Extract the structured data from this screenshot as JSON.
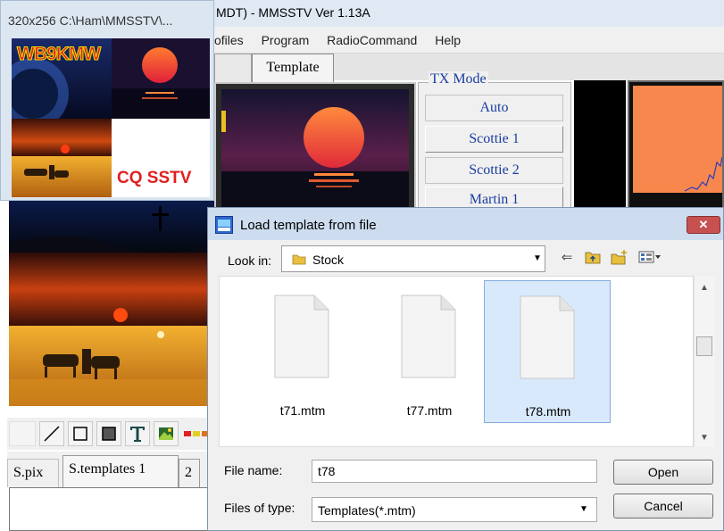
{
  "main_window": {
    "title": "MDT) - MMSSTV Ver 1.13A",
    "menu": [
      "ofiles",
      "Program",
      "RadioCommand",
      "Help"
    ],
    "tab_label": "Template"
  },
  "tx_mode": {
    "label": "TX Mode",
    "buttons": [
      "Auto",
      "Scottie 1",
      "Scottie 2",
      "Martin 1"
    ]
  },
  "left_panel": {
    "tabs": [
      "S.pix",
      "S.templates 1",
      "2"
    ],
    "tool_icons": [
      "line-tool-icon",
      "rectangle-tool-icon",
      "filled-rectangle-tool-icon",
      "text-tool-icon",
      "picture-tool-icon",
      "color-bar-icon"
    ]
  },
  "thumbnail": {
    "title": "320x256 C:\\Ham\\MMSSTV\\...",
    "callsign": "WB9KMW",
    "caption": "CQ SSTV"
  },
  "dialog": {
    "title": "Load template from file",
    "look_in_label": "Look in:",
    "look_in_value": "Stock",
    "files": [
      {
        "name": "t71.mtm",
        "selected": false
      },
      {
        "name": "t77.mtm",
        "selected": false
      },
      {
        "name": "t78.mtm",
        "selected": true
      }
    ],
    "file_name_label": "File name:",
    "file_name_value": "t78",
    "file_type_label": "Files of type:",
    "file_type_value": "Templates(*.mtm)",
    "open_label": "Open",
    "cancel_label": "Cancel"
  },
  "colors": {
    "accent_blue": "#1a3ca0",
    "orange": "#f7874c",
    "selection": "#d8e9fb"
  }
}
